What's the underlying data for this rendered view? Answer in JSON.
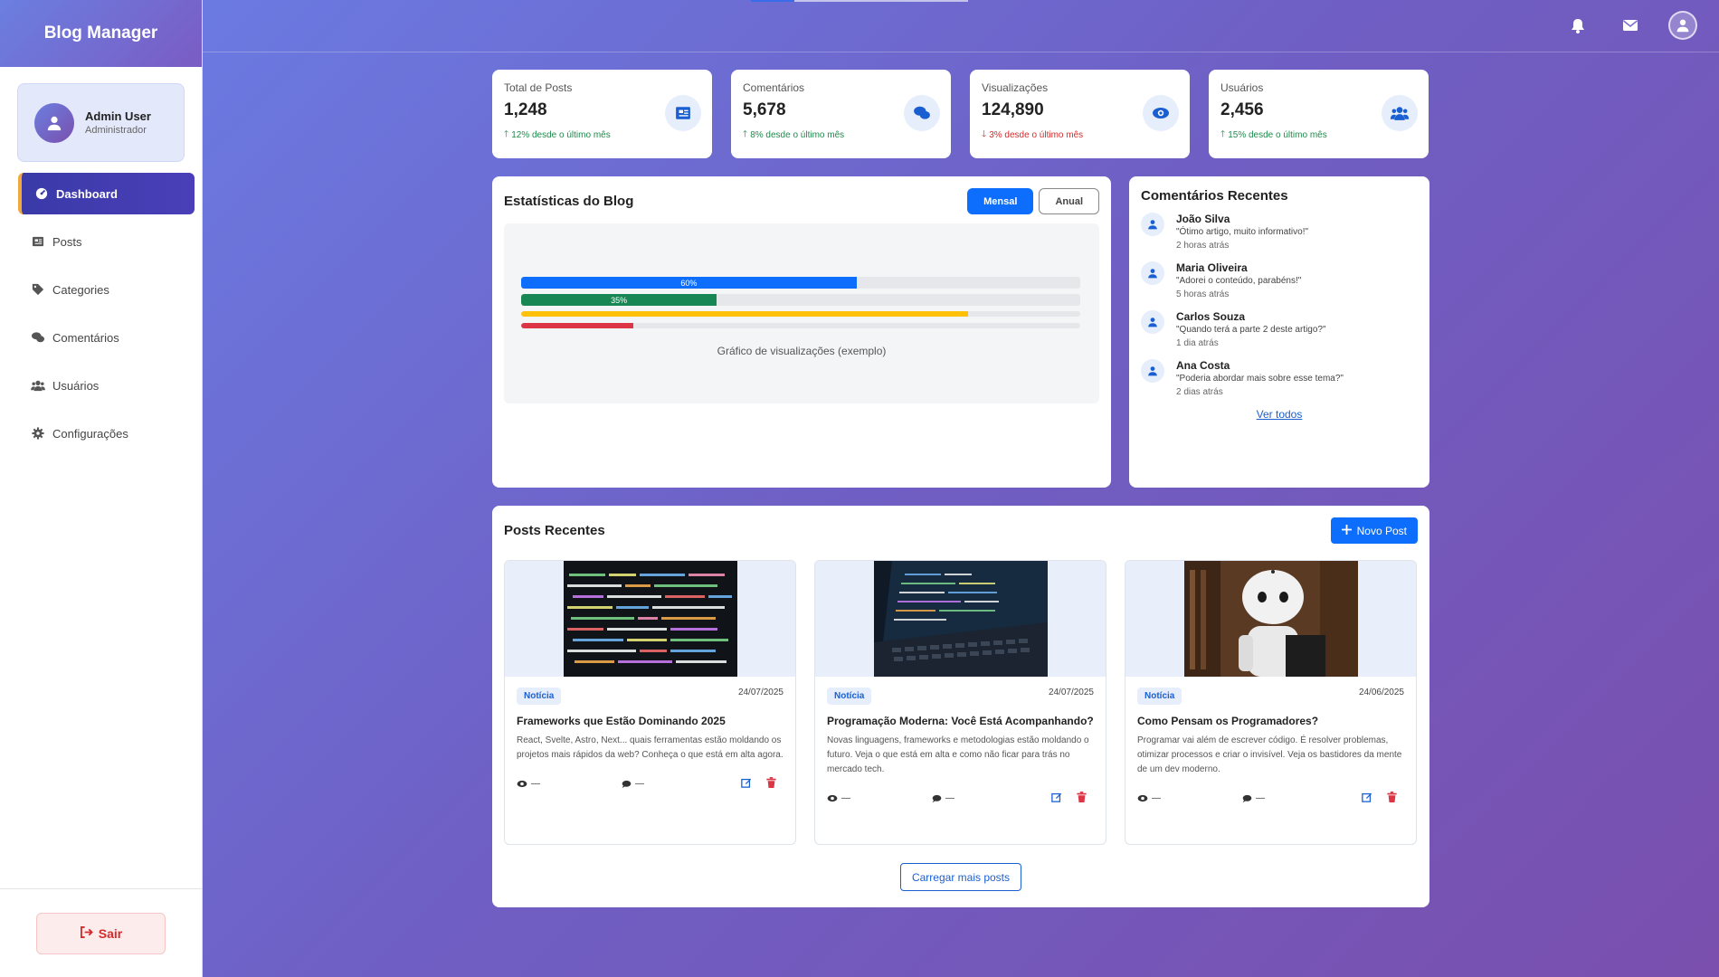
{
  "sidebar": {
    "brand": "Blog Manager",
    "user": {
      "name": "Admin User",
      "role": "Administrador"
    },
    "items": [
      {
        "label": "Dashboard",
        "icon": "gauge-icon"
      },
      {
        "label": "Posts",
        "icon": "newspaper-icon"
      },
      {
        "label": "Categories",
        "icon": "tags-icon"
      },
      {
        "label": "Comentários",
        "icon": "comments-icon"
      },
      {
        "label": "Usuários",
        "icon": "users-icon"
      },
      {
        "label": "Configurações",
        "icon": "gear-icon"
      }
    ],
    "logout_label": "Sair"
  },
  "topbar": {
    "icons": [
      "bell-icon",
      "envelope-icon",
      "user-circle-icon"
    ]
  },
  "stats": [
    {
      "label": "Total de Posts",
      "value": "1,248",
      "trend": "12% desde o último mês",
      "direction": "up",
      "icon": "newspaper-icon"
    },
    {
      "label": "Comentários",
      "value": "5,678",
      "trend": "8% desde o último mês",
      "direction": "up",
      "icon": "comments-icon"
    },
    {
      "label": "Visualizações",
      "value": "124,890",
      "trend": "3% desde o último mês",
      "direction": "down",
      "icon": "eye-icon"
    },
    {
      "label": "Usuários",
      "value": "2,456",
      "trend": "15% desde o último mês",
      "direction": "up",
      "icon": "users-icon"
    }
  ],
  "chart": {
    "title": "Estatísticas do Blog",
    "toggle": {
      "active": "Mensal",
      "inactive": "Anual"
    },
    "caption": "Gráfico de visualizações (exemplo)"
  },
  "chart_data": {
    "type": "bar",
    "orientation": "horizontal",
    "values": [
      60,
      35,
      80,
      20
    ],
    "labels": [
      "60%",
      "35%",
      "",
      ""
    ],
    "colors": [
      "#0d6efd",
      "#198754",
      "#ffc107",
      "#dc3545"
    ],
    "xlim": [
      0,
      100
    ],
    "grid": false
  },
  "comments": {
    "title": "Comentários Recentes",
    "items": [
      {
        "name": "João Silva",
        "text": "\"Ótimo artigo, muito informativo!\"",
        "time": "2 horas atrás"
      },
      {
        "name": "Maria Oliveira",
        "text": "\"Adorei o conteúdo, parabéns!\"",
        "time": "5 horas atrás"
      },
      {
        "name": "Carlos Souza",
        "text": "\"Quando terá a parte 2 deste artigo?\"",
        "time": "1 dia atrás"
      },
      {
        "name": "Ana Costa",
        "text": "\"Poderia abordar mais sobre esse tema?\"",
        "time": "2 dias atrás"
      }
    ],
    "see_all": "Ver todos"
  },
  "posts": {
    "title": "Posts Recentes",
    "new_label": "Novo Post",
    "items": [
      {
        "badge": "Notícia",
        "date": "24/07/2025",
        "title": "Frameworks que Estão Dominando 2025",
        "desc": "React, Svelte, Astro, Next... quais ferramentas estão moldando os projetos mais rápidos da web? Conheça o que está em alta agora.",
        "views": "—",
        "comments": "—"
      },
      {
        "badge": "Notícia",
        "date": "24/07/2025",
        "title": "Programação Moderna: Você Está Acompanhando?",
        "desc": "Novas linguagens, frameworks e metodologias estão moldando o futuro. Veja o que está em alta e como não ficar para trás no mercado tech.",
        "views": "—",
        "comments": "—"
      },
      {
        "badge": "Notícia",
        "date": "24/06/2025",
        "title": "Como Pensam os Programadores?",
        "desc": "Programar vai além de escrever código. É resolver problemas, otimizar processos e criar o invisível. Veja os bastidores da mente de um dev moderno.",
        "views": "—",
        "comments": "—"
      }
    ],
    "load_more": "Carregar mais posts"
  },
  "colors": {
    "accent": "#0d6efd",
    "sidebar_active": "#3a3aa8",
    "danger": "#dc3545",
    "success": "#198754"
  }
}
